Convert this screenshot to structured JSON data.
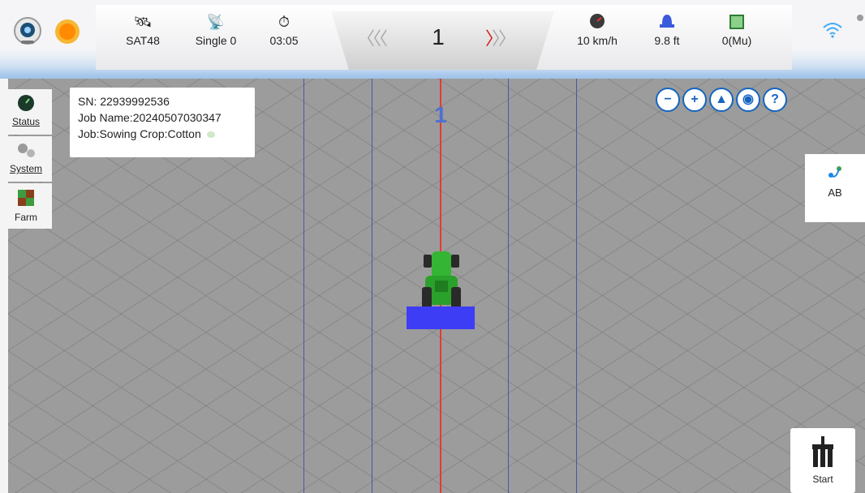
{
  "topbar": {
    "satellites": "SAT48",
    "signal_mode": "Single 0",
    "time": "03:05",
    "swath_number": "1",
    "speed": "10 km/h",
    "width": "9.8 ft",
    "area": "0(Mu)",
    "icons": {
      "camera": "camera-icon",
      "weather": "sun-icon",
      "satellite": "satellite-icon",
      "antenna": "antenna-icon",
      "clock": "clock-icon",
      "speedometer": "speedometer-icon",
      "implement": "implement-icon",
      "area": "area-icon",
      "wifi": "wifi-icon"
    }
  },
  "sidebar": {
    "items": [
      {
        "label": "Status",
        "icon": "status-icon"
      },
      {
        "label": "System",
        "icon": "gears-icon"
      },
      {
        "label": "Farm",
        "icon": "farm-icon"
      }
    ]
  },
  "info": {
    "sn": "SN: 22939992536",
    "job_name": "Job Name:20240507030347",
    "job": "Job:Sowing  Crop:Cotton"
  },
  "map": {
    "line_number": "1",
    "colors": {
      "guide_line": "#e53935",
      "swath_line": "#3f51b5",
      "implement": "#3d3df5",
      "tractor": "#2eaa2e"
    }
  },
  "controls": {
    "zoom_out": "zoom-out-icon",
    "zoom_in": "zoom-in-icon",
    "navigate": "navigate-icon",
    "locate": "locate-icon",
    "help": "help-icon"
  },
  "ab_panel": {
    "label": "AB",
    "icon": "ab-line-icon"
  },
  "start_panel": {
    "label": "Start",
    "icon": "start-implement-icon"
  }
}
